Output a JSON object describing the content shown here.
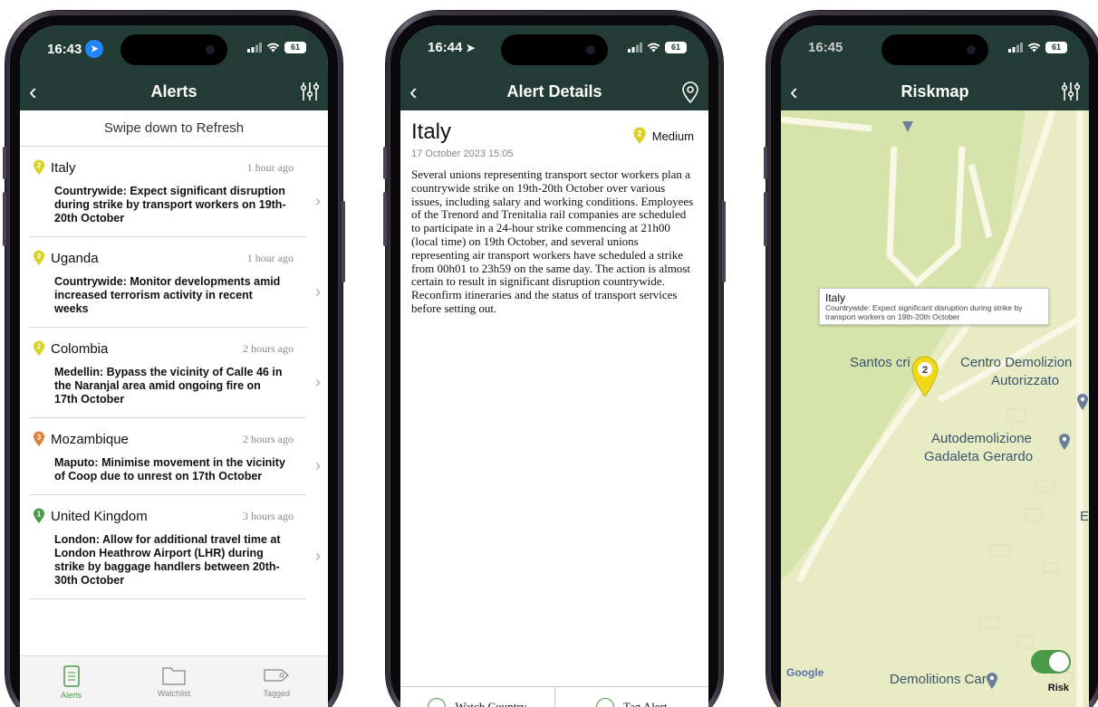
{
  "colors": {
    "header": "#223c35",
    "accent": "#4b9a49",
    "medium": "#d9d220",
    "high": "#e0803a",
    "low": "#4b9a49"
  },
  "screen1": {
    "time": "16:43",
    "battery": "61",
    "title": "Alerts",
    "refresh_text": "Swipe down to Refresh",
    "alerts": [
      {
        "country": "Italy",
        "level": "2",
        "ago": "1 hour ago",
        "desc": "Countrywide: Expect significant disruption during strike by transport workers on 19th-20th October"
      },
      {
        "country": "Uganda",
        "level": "2",
        "ago": "1 hour ago",
        "desc": "Countrywide: Monitor developments amid increased terrorism activity in recent weeks"
      },
      {
        "country": "Colombia",
        "level": "2",
        "ago": "2 hours ago",
        "desc": "Medellin: Bypass the vicinity of Calle 46 in the Naranjal area amid ongoing fire on 17th October"
      },
      {
        "country": "Mozambique",
        "level": "3",
        "ago": "2 hours ago",
        "desc": "Maputo: Minimise movement in the vicinity of Coop due to unrest on 17th October"
      },
      {
        "country": "United Kingdom",
        "level": "1",
        "ago": "3 hours ago",
        "desc": "London: Allow for additional travel time at London Heathrow Airport (LHR) during strike by baggage handlers between 20th-30th October"
      }
    ],
    "tabs": [
      {
        "label": "Alerts",
        "icon": "document-icon"
      },
      {
        "label": "Watchlist",
        "icon": "folder-icon"
      },
      {
        "label": "Tagged",
        "icon": "tag-icon"
      }
    ]
  },
  "screen2": {
    "time": "16:44",
    "battery": "61",
    "title": "Alert Details",
    "country": "Italy",
    "date": "17 October 2023 15:05",
    "level": "2",
    "severity": "Medium",
    "body": "Several unions representing transport sector workers plan a countrywide strike on 19th-20th October over various issues, including salary and working conditions. Employees of the Trenord and Trenitalia rail companies are scheduled to participate in a 24-hour strike commencing at 21h00 (local time) on 19th October, and several unions representing air transport workers have scheduled a strike from 00h01 to 23h59 on the same day. The action is almost certain to result in significant disruption countrywide. Reconfirm itineraries and the status of transport services before setting out.",
    "watch_label": "Watch Country",
    "tag_label": "Tag Alert"
  },
  "screen3": {
    "time": "16:45",
    "battery": "61",
    "title": "Riskmap",
    "callout_title": "Italy",
    "callout_text": "Countrywide: Expect significant disruption during strike by transport workers on 19th-20th October",
    "pin_level": "2",
    "labels": [
      "Santos cri",
      "Centro Demolizion",
      "Autorizzato",
      "Autodemolizione",
      "Gadaleta Gerardo",
      "Demolitions Car",
      "E"
    ],
    "google": "Google",
    "risk_label": "Risk"
  }
}
